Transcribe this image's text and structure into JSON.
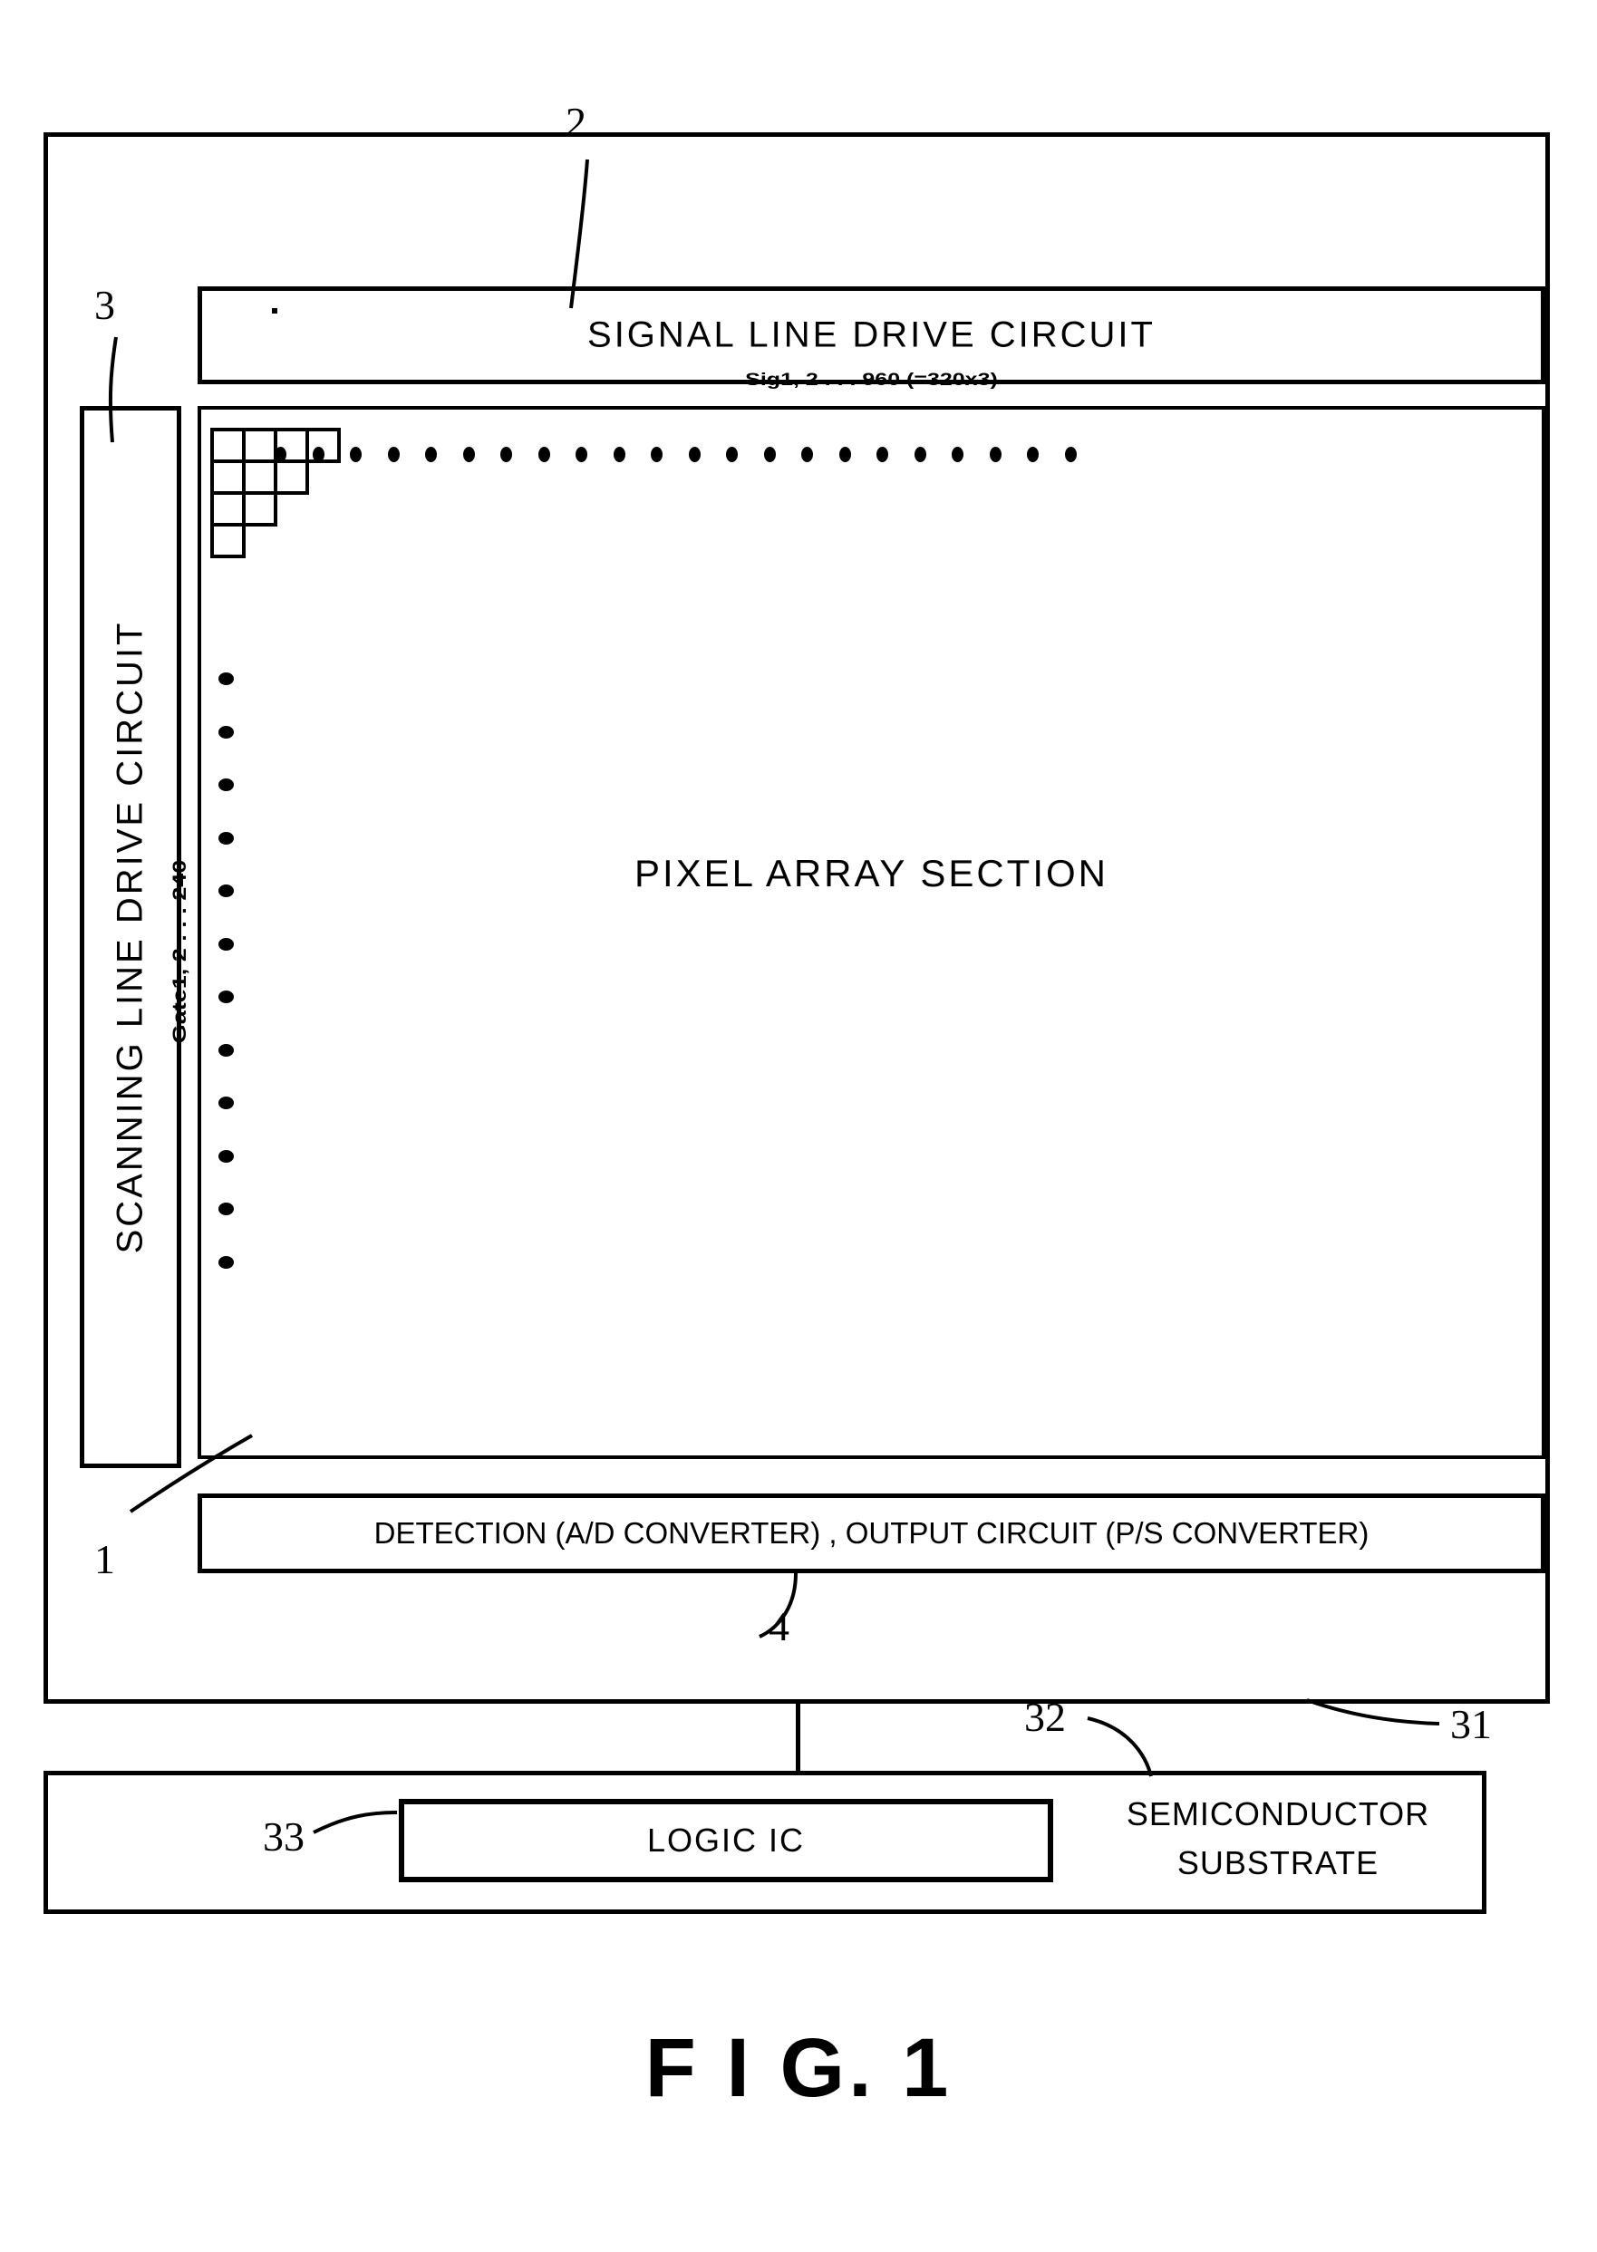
{
  "figure": {
    "caption": "F I G. 1"
  },
  "blocks": {
    "signal_line_drive_circuit": {
      "label": "SIGNAL   LINE   DRIVE   CIRCUIT",
      "ref": "2",
      "signal_caption": "Sig1, 2 . . . 960 (=320x3)"
    },
    "scanning_line_drive_circuit": {
      "label": "SCANNING LINE DRIVE CIRCUIT",
      "ref": "3",
      "gate_caption": "Gate1, 2 . . . 240"
    },
    "pixel_array_section": {
      "label": "PIXEL   ARRAY   SECTION",
      "ref": "1"
    },
    "detection_output_circuit": {
      "label": "DETECTION (A/D  CONVERTER) , OUTPUT  CIRCUIT (P/S  CONVERTER)",
      "ref": "4"
    },
    "display_chip": {
      "ref": "31"
    },
    "semiconductor_substrate": {
      "label_line1": "SEMICONDUCTOR",
      "label_line2": "SUBSTRATE",
      "ref": "32"
    },
    "logic_ic": {
      "label": "LOGIC  IC",
      "ref": "33"
    }
  },
  "pixel_grid": {
    "rows": [
      4,
      3,
      2,
      1
    ],
    "cell_size": 39
  },
  "dots": {
    "horizontal_count": 22,
    "vertical_count": 12
  },
  "colors": {
    "ink": "#000000",
    "paper": "#ffffff"
  }
}
